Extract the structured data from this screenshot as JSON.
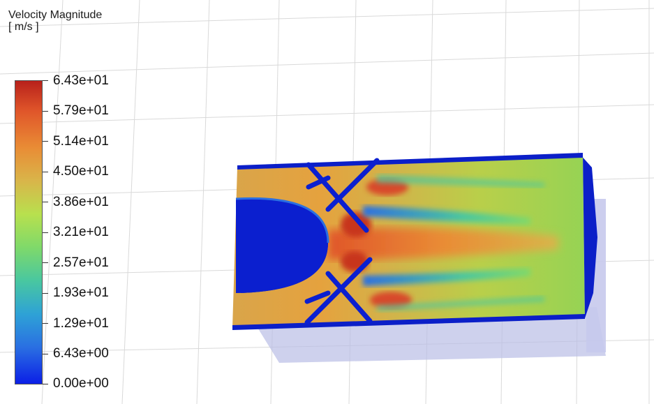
{
  "legend": {
    "title_line1": "Velocity Magnitude",
    "title_line2": "[ m/s ]",
    "labels": [
      "6.43e+01",
      "5.79e+01",
      "5.14e+01",
      "4.50e+01",
      "3.86e+01",
      "3.21e+01",
      "2.57e+01",
      "1.93e+01",
      "1.29e+01",
      "6.43e+00",
      "0.00e+00"
    ],
    "colors": {
      "max": "#b8211b",
      "mid": "#b8e04e",
      "min": "#0b1fe6"
    }
  },
  "scene": {
    "background": "#ffffff",
    "grid_color": "#d9d9d9"
  }
}
